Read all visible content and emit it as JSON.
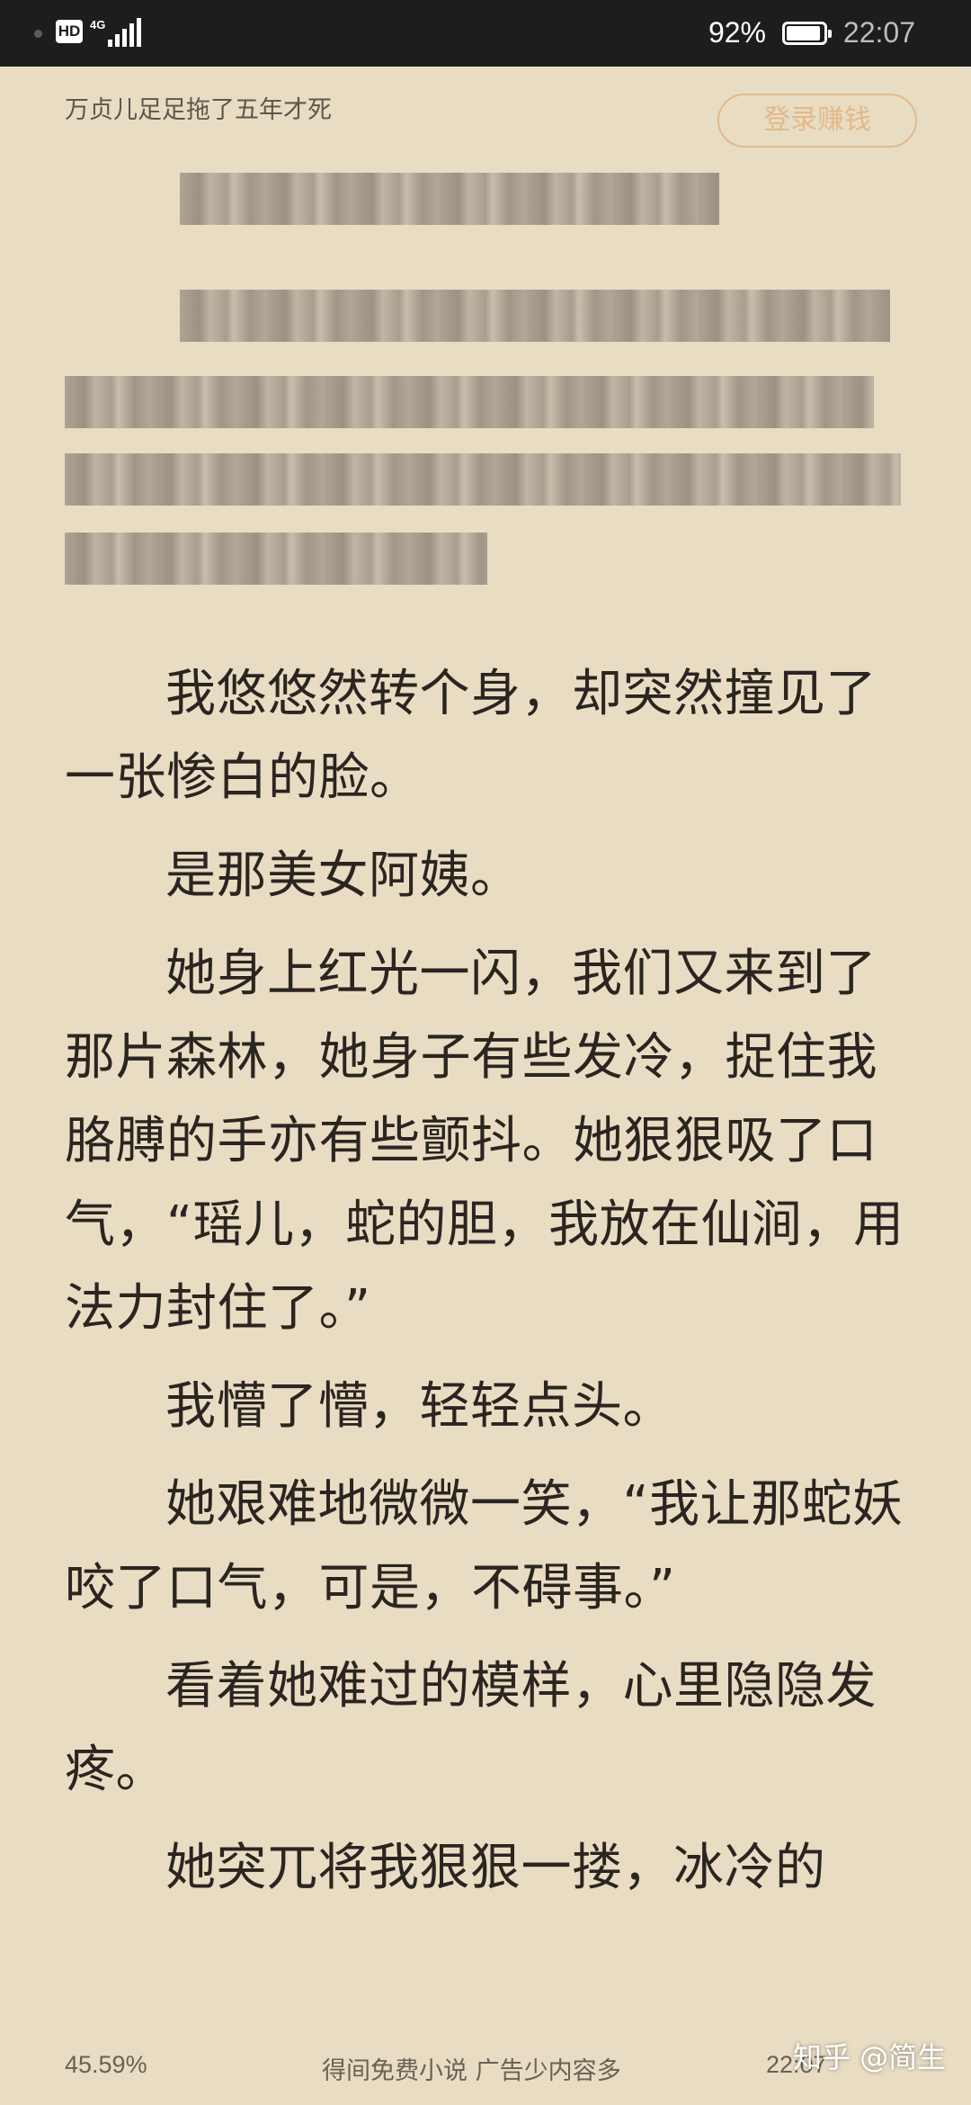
{
  "status_bar": {
    "hd": "HD",
    "network": "4G",
    "battery_percent": "92%",
    "battery_level": 0.92,
    "time": "22:07"
  },
  "header": {
    "chapter_title": "万贞儿足足拖了五年才死",
    "login_button": "登录赚钱"
  },
  "reading": {
    "paragraphs": [
      "我悠悠然转个身，却突然撞见了一张惨白的脸。",
      "是那美女阿姨。",
      "她身上红光一闪，我们又来到了那片森林，她身子有些发冷，捉住我胳膊的手亦有些颤抖。她狠狠吸了口气，“瑶儿，蛇的胆，我放在仙涧，用法力封住了。”",
      "我懵了懵，轻轻点头。",
      "她艰难地微微一笑，“我让那蛇妖咬了口气，可是，不碍事。”",
      "看着她难过的模样，心里隐隐发疼。",
      "她突兀将我狠狠一搂，冰冷的"
    ]
  },
  "footer": {
    "progress": "45.59%",
    "ad_text": "得间免费小说 广告少内容多",
    "time": "22:07"
  },
  "watermark": "知乎 @简生"
}
